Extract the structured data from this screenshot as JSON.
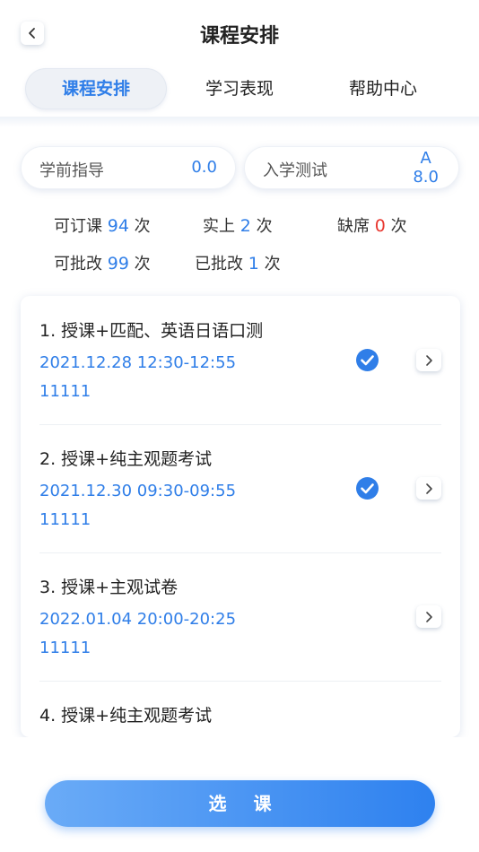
{
  "header": {
    "title": "课程安排",
    "tabs": [
      {
        "label": "课程安排",
        "active": true
      },
      {
        "label": "学习表现",
        "active": false
      },
      {
        "label": "帮助中心",
        "active": false
      }
    ]
  },
  "scores": {
    "pre_guide": {
      "label": "学前指导",
      "value": "0.0"
    },
    "entrance_test": {
      "label": "入学测试",
      "grade": "A",
      "value": "8.0"
    }
  },
  "stats": {
    "bookable": {
      "prefix": "可订课",
      "value": "94",
      "suffix": "次"
    },
    "attended": {
      "prefix": "实上",
      "value": "2",
      "suffix": "次"
    },
    "absent": {
      "prefix": "缺席",
      "value": "0",
      "suffix": "次"
    },
    "to_grade": {
      "prefix": "可批改",
      "value": "99",
      "suffix": "次"
    },
    "graded": {
      "prefix": "已批改",
      "value": "1",
      "suffix": "次"
    }
  },
  "lessons": [
    {
      "name": "1. 授课+匹配、英语日语口测",
      "time": "2021.12.28 12:30-12:55",
      "code": "11111",
      "checked": true
    },
    {
      "name": "2. 授课+纯主观题考试",
      "time": "2021.12.30 09:30-09:55",
      "code": "11111",
      "checked": true
    },
    {
      "name": "3. 授课+主观试卷",
      "time": "2022.01.04 20:00-20:25",
      "code": "11111",
      "checked": false
    },
    {
      "name": "4. 授课+纯主观题考试",
      "time": "",
      "code": "",
      "checked": false
    }
  ],
  "footer": {
    "select_label": "选课"
  },
  "colors": {
    "accent": "#2f7ee8",
    "absent": "#e8372f"
  }
}
